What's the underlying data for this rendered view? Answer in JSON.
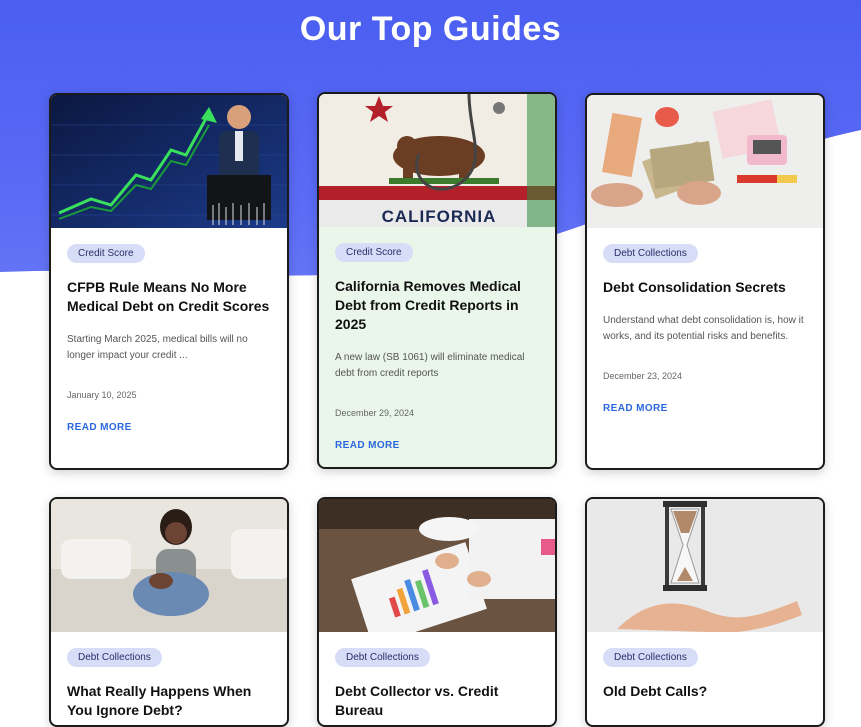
{
  "section": {
    "title": "Our Top Guides"
  },
  "cards": [
    {
      "badge": "Credit Score",
      "title": "CFPB Rule Means No More Medical Debt on Credit Scores",
      "excerpt": "Starting March 2025, medical bills will no longer impact your credit ...",
      "date": "January 10, 2025",
      "cta": "READ MORE",
      "image": "man-celebrating-rising-chart"
    },
    {
      "badge": "Credit Score",
      "title": "California Removes Medical Debt from Credit Reports in 2025",
      "excerpt": "A new law (SB 1061) will eliminate medical debt from credit reports",
      "date": "December 29, 2024",
      "cta": "READ MORE",
      "image": "california-flag-stethoscope",
      "image_text": "CALIFORNIA"
    },
    {
      "badge": "Debt Collections",
      "title": "Debt Consolidation Secrets",
      "excerpt": "Understand what debt consolidation is, how it works, and its potential risks and benefits.",
      "date": "December 23, 2024",
      "cta": "READ MORE",
      "image": "hands-counting-cash"
    },
    {
      "badge": "Debt Collections",
      "title": "What Really Happens When You Ignore Debt?",
      "image": "worried-woman-on-bed"
    },
    {
      "badge": "Debt Collections",
      "title": "Debt Collector vs. Credit Bureau",
      "image": "hands-pointing-at-charts"
    },
    {
      "badge": "Debt Collections",
      "title": "Old Debt Calls?",
      "image": "hourglass-over-hand"
    }
  ],
  "colors": {
    "hero": "#4a5ef0",
    "badge_bg": "#d7dcf7",
    "link": "#2a68e0",
    "highlight_card": "#e9f6e9"
  }
}
